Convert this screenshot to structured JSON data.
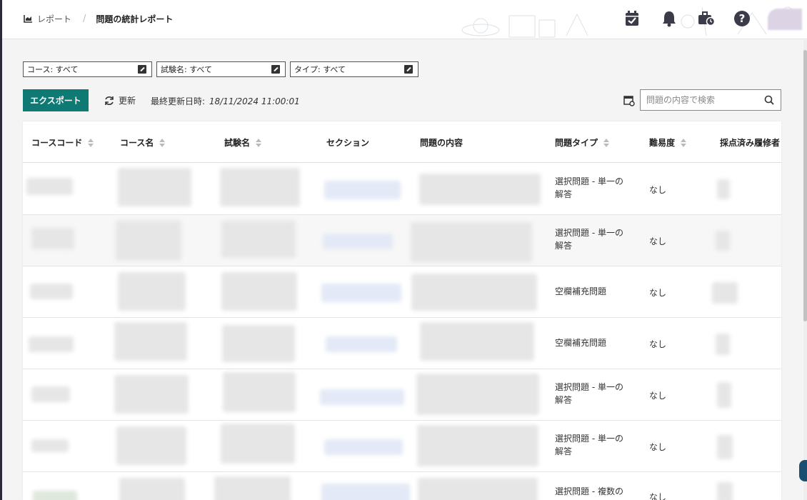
{
  "breadcrumb": {
    "home_label": "レポート",
    "separator": "/",
    "current": "問題の統計レポート"
  },
  "header_icons": [
    "calendar-check-icon",
    "bell-icon",
    "briefcase-clock-icon",
    "help-icon"
  ],
  "filters": {
    "course": "コース: すべて",
    "exam": "試験名: すべて",
    "type": "タイプ: すべて"
  },
  "toolbar": {
    "export_label": "エクスポート",
    "refresh_label": "更新",
    "last_updated_label": "最終更新日時:",
    "last_updated_value": "18/11/2024 11:00:01",
    "search_placeholder": "問題の内容で検索"
  },
  "table": {
    "columns": [
      "コースコード",
      "コース名",
      "試験名",
      "セクション",
      "問題の内容",
      "問題タイプ",
      "難易度",
      "採点済み履修者"
    ],
    "rows": [
      {
        "type_line1": "選択問題 - 単一の",
        "type_line2": "解答",
        "difficulty": "なし"
      },
      {
        "type_line1": "選択問題 - 単一の",
        "type_line2": "解答",
        "difficulty": "なし"
      },
      {
        "type_line1": "空欄補充問題",
        "type_line2": "",
        "difficulty": "なし"
      },
      {
        "type_line1": "空欄補充問題",
        "type_line2": "",
        "difficulty": "なし"
      },
      {
        "type_line1": "選択問題 - 単一の",
        "type_line2": "解答",
        "difficulty": "なし"
      },
      {
        "type_line1": "選択問題 - 単一の",
        "type_line2": "解答",
        "difficulty": "なし"
      },
      {
        "type_line1": "選択問題 - 複数の",
        "type_line2": "",
        "difficulty": "なし"
      }
    ]
  },
  "colors": {
    "accent": "#0f7a74",
    "header_bg": "#ffffff",
    "page_bg": "#f4f4f4"
  }
}
